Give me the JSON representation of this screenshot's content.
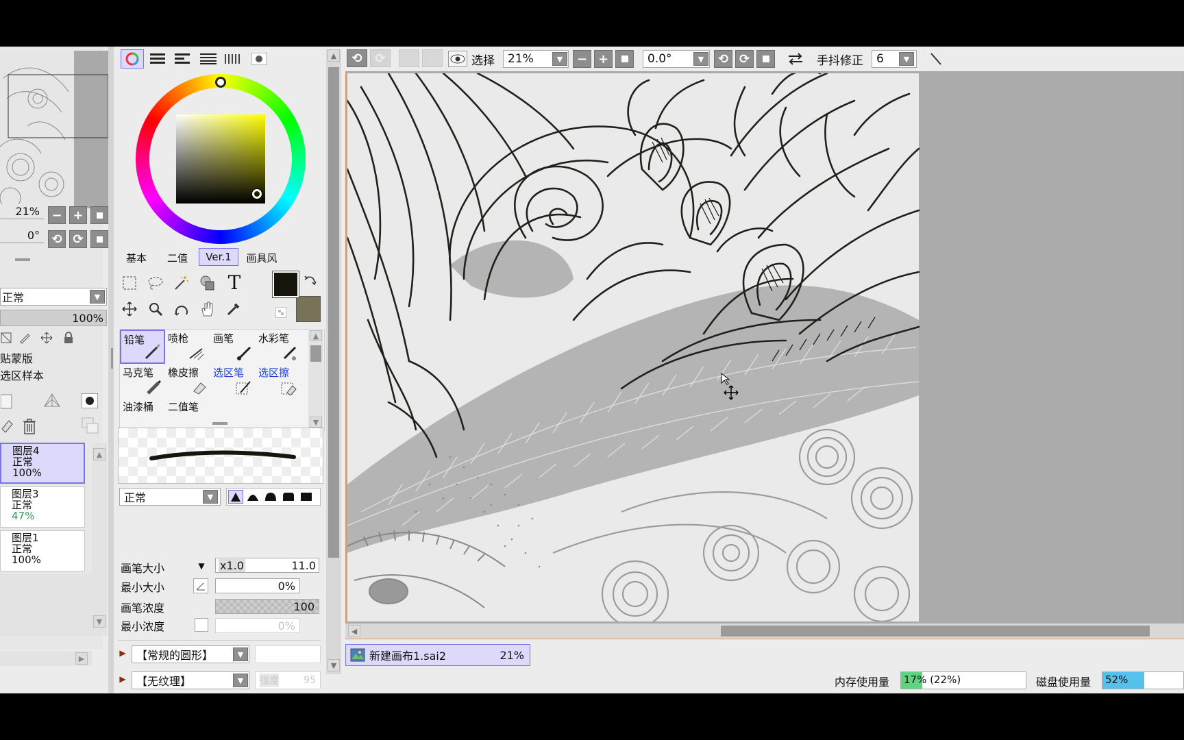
{
  "navigator": {
    "zoom": "21%",
    "angle": "0°"
  },
  "layer_panel": {
    "blend_mode": "正常",
    "opacity": "100%",
    "clip_label": "贴蒙版",
    "sample_label": "选区样本",
    "layers": [
      {
        "name": "图层4",
        "mode": "正常",
        "opacity": "100%",
        "selected": true
      },
      {
        "name": "图层3",
        "mode": "正常",
        "opacity": "47%",
        "selected": false
      },
      {
        "name": "图层1",
        "mode": "正常",
        "opacity": "100%",
        "selected": false
      }
    ]
  },
  "color_panel": {
    "tabs": [
      "基本",
      "二值",
      "Ver.1",
      "画具风"
    ],
    "active_tab": "Ver.1",
    "primary_color": "#16150c",
    "secondary_color": "#787358"
  },
  "brush_tools": [
    {
      "label": "铅笔",
      "selected": true
    },
    {
      "label": "喷枪"
    },
    {
      "label": "画笔"
    },
    {
      "label": "水彩笔"
    },
    {
      "label": "马克笔"
    },
    {
      "label": "橡皮擦"
    },
    {
      "label": "选区笔",
      "blue": true
    },
    {
      "label": "选区擦",
      "blue": true
    },
    {
      "label": "油漆桶"
    },
    {
      "label": "二值笔"
    }
  ],
  "brush_settings": {
    "blend_mode": "正常",
    "size_label": "画笔大小",
    "size_multiplier": "x1.0",
    "size_value": "11.0",
    "min_size_label": "最小大小",
    "min_size_value": "0%",
    "density_label": "画笔浓度",
    "density_value": "100",
    "min_density_label": "最小浓度",
    "min_density_value": "0%",
    "shape": "【常规的圆形】",
    "texture": "【无纹理】",
    "texture_strength_label": "强度",
    "texture_strength_value": "95"
  },
  "toolbar": {
    "select_label": "选择",
    "zoom": "21%",
    "angle": "0.0°",
    "stabilizer_label": "手抖修正",
    "stabilizer_value": "6"
  },
  "document_tab": {
    "name": "新建画布1.sai2",
    "zoom": "21%"
  },
  "status_bar": {
    "memory_label": "内存使用量",
    "memory_value": "17%",
    "memory_detail": "(22%)",
    "memory_fill": 0.17,
    "disk_label": "磁盘使用量",
    "disk_value": "52%",
    "disk_fill": 0.52
  },
  "colors": {
    "accent": "#7a74e8",
    "selected_bg": "#dcd9fb",
    "memory_bar": "#5fd47f",
    "disk_bar": "#56c2ec",
    "opacity_green": "#2d9a52"
  }
}
